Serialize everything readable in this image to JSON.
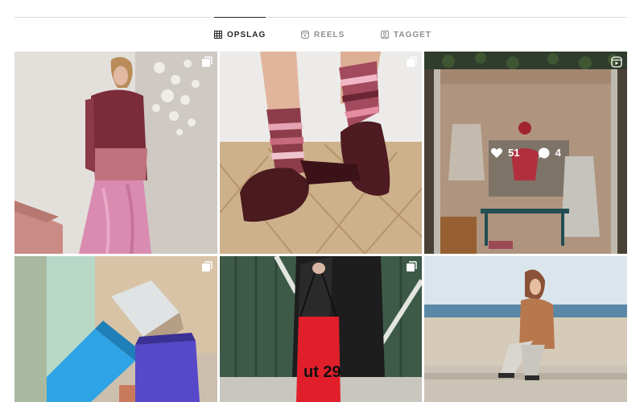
{
  "tabs": [
    {
      "label": "OPSLAG",
      "icon": "grid-icon",
      "active": true
    },
    {
      "label": "REELS",
      "icon": "reels-icon",
      "active": false
    },
    {
      "label": "TAGGET",
      "icon": "tagged-icon",
      "active": false
    }
  ],
  "posts": [
    {
      "badge": "carousel-icon"
    },
    {
      "badge": "carousel-icon"
    },
    {
      "badge": "reel-icon",
      "hover": {
        "likes": "51",
        "comments": "4"
      }
    },
    {
      "badge": "carousel-icon"
    },
    {
      "badge": "carousel-icon"
    },
    {
      "badge": ""
    }
  ],
  "photo_text": {
    "bag_print": "ut 29"
  }
}
